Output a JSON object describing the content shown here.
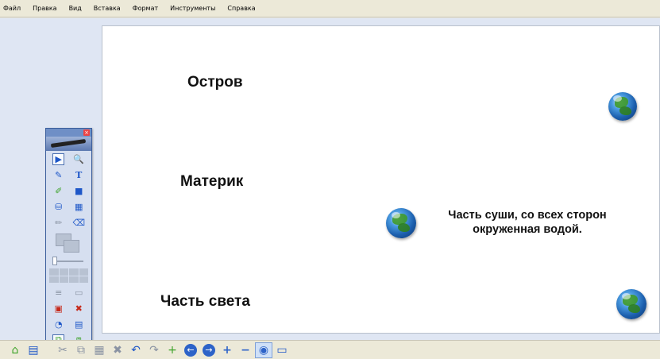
{
  "menu": {
    "file": "Файл",
    "edit": "Правка",
    "view": "Вид",
    "insert": "Вставка",
    "format": "Формат",
    "tools": "Инструменты",
    "help": "Справка"
  },
  "slide": {
    "term_island": "Остров",
    "term_mainland": "Материк",
    "term_part_world": "Часть света",
    "definition": "Часть суши, со всех сторон окруженная водой."
  },
  "floating_toolbar": {
    "close_glyph": "×",
    "select_glyph": "▶",
    "zoom_glyph": "🔍",
    "pen_glyph": "✎",
    "text_glyph": "T",
    "highlighter_glyph": "✐",
    "shape_glyph": "■",
    "fill_glyph": "⛁",
    "table_glyph": "▦",
    "pencil_glyph": "✏",
    "eraser_glyph": "⌫",
    "lines_glyph": "≡",
    "screen_glyph": "▭",
    "capture_glyph": "▣",
    "delete_glyph": "✖",
    "pie_glyph": "◔",
    "save_glyph": "▤",
    "page1_glyph": "⧉",
    "page2_glyph": "⧈"
  },
  "bottom_toolbar": {
    "new_glyph": "⌂",
    "save_glyph": "▤",
    "cut_glyph": "✂",
    "copy_glyph": "⧉",
    "paste_glyph": "▦",
    "delete_glyph": "✖",
    "undo_glyph": "↶",
    "redo_glyph": "↷",
    "add_page_glyph": "+",
    "prev_glyph": "←",
    "next_glyph": "→",
    "zoom_in_glyph": "+",
    "zoom_out_glyph": "−",
    "zoom_fit_glyph": "◉",
    "view_glyph": "▭"
  },
  "colors": {
    "accent": "#2d63c8",
    "workspace": "#dfe6f3",
    "toolbar_border": "#3b5e9c"
  }
}
